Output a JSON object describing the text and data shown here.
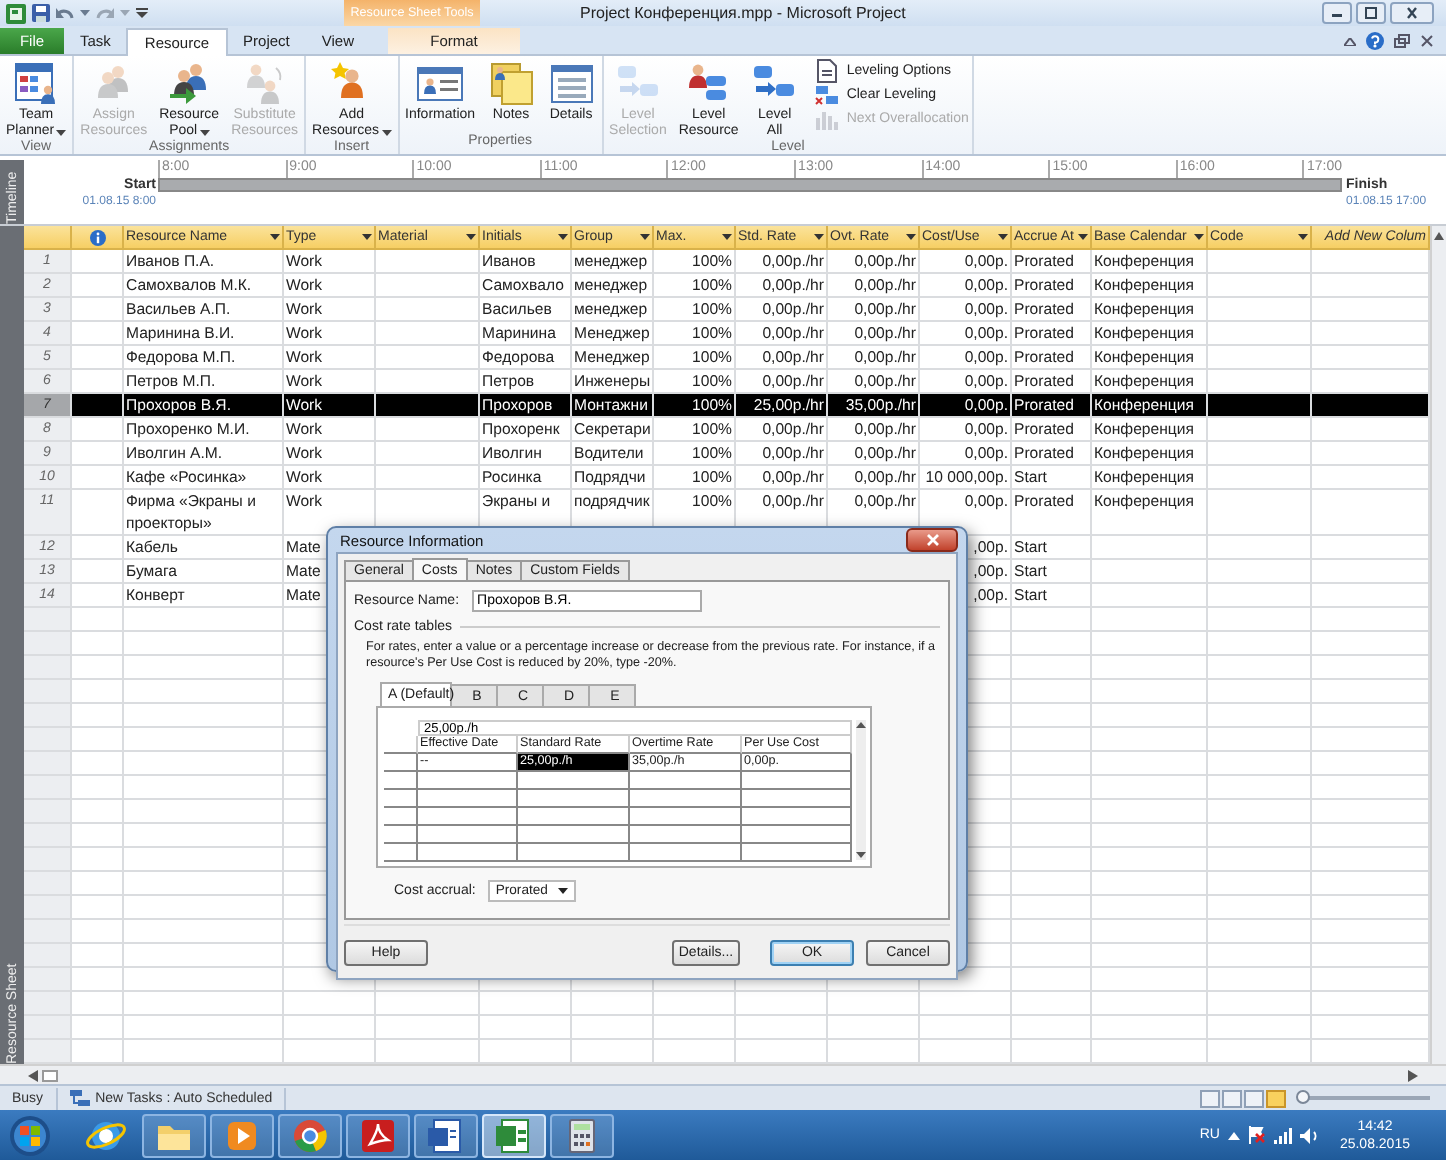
{
  "window": {
    "title": "Project Конференция.mpp - Microsoft Project",
    "contextual_group": "Resource Sheet Tools"
  },
  "tabs": [
    {
      "label": "File",
      "kind": "file",
      "selected": false
    },
    {
      "label": "Task",
      "kind": "normal",
      "selected": false
    },
    {
      "label": "Resource",
      "kind": "normal",
      "selected": true
    },
    {
      "label": "Project",
      "kind": "normal",
      "selected": false
    },
    {
      "label": "View",
      "kind": "normal",
      "selected": false
    },
    {
      "label": "Format",
      "kind": "contextual",
      "selected": false
    }
  ],
  "ribbon": {
    "groups": [
      {
        "label": "View",
        "commands": [
          {
            "lines": [
              "Team",
              "Planner"
            ],
            "dropdown": true,
            "disabled": false,
            "kind": "large"
          }
        ]
      },
      {
        "label": "Assignments",
        "commands": [
          {
            "lines": [
              "Assign",
              "Resources"
            ],
            "dropdown": false,
            "disabled": true,
            "kind": "large"
          },
          {
            "lines": [
              "Resource",
              "Pool"
            ],
            "dropdown": true,
            "disabled": false,
            "kind": "large"
          },
          {
            "lines": [
              "Substitute",
              "Resources"
            ],
            "dropdown": false,
            "disabled": true,
            "kind": "large"
          }
        ]
      },
      {
        "label": "Insert",
        "commands": [
          {
            "lines": [
              "Add",
              "Resources"
            ],
            "dropdown": true,
            "disabled": false,
            "kind": "large"
          }
        ]
      },
      {
        "label": "Properties",
        "commands": [
          {
            "lines": [
              "Information"
            ],
            "dropdown": false,
            "disabled": false,
            "kind": "large"
          },
          {
            "lines": [
              "Notes"
            ],
            "dropdown": false,
            "disabled": false,
            "kind": "large"
          },
          {
            "lines": [
              "Details"
            ],
            "dropdown": false,
            "disabled": false,
            "kind": "large"
          }
        ]
      },
      {
        "label": "Level",
        "commands": [
          {
            "lines": [
              "Level",
              "Selection"
            ],
            "dropdown": false,
            "disabled": true,
            "kind": "large"
          },
          {
            "lines": [
              "Level",
              "Resource"
            ],
            "dropdown": false,
            "disabled": false,
            "kind": "large"
          },
          {
            "lines": [
              "Level",
              "All"
            ],
            "dropdown": false,
            "disabled": false,
            "kind": "large"
          },
          {
            "lines": [
              "Leveling Options"
            ],
            "dropdown": false,
            "disabled": false,
            "kind": "small"
          },
          {
            "lines": [
              "Clear Leveling"
            ],
            "dropdown": false,
            "disabled": false,
            "kind": "small"
          },
          {
            "lines": [
              "Next Overallocation"
            ],
            "dropdown": false,
            "disabled": true,
            "kind": "small"
          }
        ]
      }
    ]
  },
  "timeline": {
    "label": "Timeline",
    "start_label": "Start",
    "start_date": "01.08.15 8:00",
    "finish_label": "Finish",
    "finish_date": "01.08.15 17:00",
    "ticks": [
      "8:00",
      "9:00",
      "10:00",
      "11:00",
      "12:00",
      "13:00",
      "14:00",
      "15:00",
      "16:00",
      "17:00"
    ]
  },
  "sheet": {
    "label": "Resource Sheet",
    "columns": [
      {
        "kind": "indicator"
      },
      {
        "label": "Resource Name",
        "kind": "field"
      },
      {
        "label": "Type",
        "kind": "field"
      },
      {
        "label": "Material",
        "kind": "field"
      },
      {
        "label": "Initials",
        "kind": "field"
      },
      {
        "label": "Group",
        "kind": "field"
      },
      {
        "label": "Max.",
        "kind": "field"
      },
      {
        "label": "Std. Rate",
        "kind": "field"
      },
      {
        "label": "Ovt. Rate",
        "kind": "field"
      },
      {
        "label": "Cost/Use",
        "kind": "field"
      },
      {
        "label": "Accrue At",
        "kind": "field"
      },
      {
        "label": "Base Calendar",
        "kind": "field"
      },
      {
        "label": "Code",
        "kind": "field"
      },
      {
        "label": "Add New Colum",
        "kind": "add"
      }
    ],
    "rows": [
      {
        "number": "1",
        "name": "Иванов П.А.",
        "type": "Work",
        "initials": "Иванов",
        "group": "менеджер",
        "max": "100%",
        "std_rate": "0,00р./hr",
        "ovt_rate": "0,00р./hr",
        "cost_use": "0,00р.",
        "accrue_at": "Prorated",
        "base_calendar": "Конференция",
        "selected": false
      },
      {
        "number": "2",
        "name": "Самохвалов М.К.",
        "type": "Work",
        "initials": "Самохвало",
        "group": "менеджер",
        "max": "100%",
        "std_rate": "0,00р./hr",
        "ovt_rate": "0,00р./hr",
        "cost_use": "0,00р.",
        "accrue_at": "Prorated",
        "base_calendar": "Конференция",
        "selected": false
      },
      {
        "number": "3",
        "name": "Васильев А.П.",
        "type": "Work",
        "initials": "Васильев",
        "group": "менеджер",
        "max": "100%",
        "std_rate": "0,00р./hr",
        "ovt_rate": "0,00р./hr",
        "cost_use": "0,00р.",
        "accrue_at": "Prorated",
        "base_calendar": "Конференция",
        "selected": false
      },
      {
        "number": "4",
        "name": "Маринина В.И.",
        "type": "Work",
        "initials": "Маринина",
        "group": "Менеджер",
        "max": "100%",
        "std_rate": "0,00р./hr",
        "ovt_rate": "0,00р./hr",
        "cost_use": "0,00р.",
        "accrue_at": "Prorated",
        "base_calendar": "Конференция",
        "selected": false
      },
      {
        "number": "5",
        "name": "Федорова М.П.",
        "type": "Work",
        "initials": "Федорова",
        "group": "Менеджер",
        "max": "100%",
        "std_rate": "0,00р./hr",
        "ovt_rate": "0,00р./hr",
        "cost_use": "0,00р.",
        "accrue_at": "Prorated",
        "base_calendar": "Конференция",
        "selected": false
      },
      {
        "number": "6",
        "name": "Петров М.П.",
        "type": "Work",
        "initials": "Петров",
        "group": "Инженеры",
        "max": "100%",
        "std_rate": "0,00р./hr",
        "ovt_rate": "0,00р./hr",
        "cost_use": "0,00р.",
        "accrue_at": "Prorated",
        "base_calendar": "Конференция",
        "selected": false
      },
      {
        "number": "7",
        "name": "Прохоров В.Я.",
        "type": "Work",
        "initials": "Прохоров",
        "group": "Монтажни",
        "max": "100%",
        "std_rate": "25,00р./hr",
        "ovt_rate": "35,00р./hr",
        "cost_use": "0,00р.",
        "accrue_at": "Prorated",
        "base_calendar": "Конференция",
        "selected": true
      },
      {
        "number": "8",
        "name": "Прохоренко М.И.",
        "type": "Work",
        "initials": "Прохоренк",
        "group": "Секретари",
        "max": "100%",
        "std_rate": "0,00р./hr",
        "ovt_rate": "0,00р./hr",
        "cost_use": "0,00р.",
        "accrue_at": "Prorated",
        "base_calendar": "Конференция",
        "selected": false
      },
      {
        "number": "9",
        "name": "Иволгин А.М.",
        "type": "Work",
        "initials": "Иволгин",
        "group": "Водители",
        "max": "100%",
        "std_rate": "0,00р./hr",
        "ovt_rate": "0,00р./hr",
        "cost_use": "0,00р.",
        "accrue_at": "Prorated",
        "base_calendar": "Конференция",
        "selected": false
      },
      {
        "number": "10",
        "name": "Кафе «Росинка»",
        "type": "Work",
        "initials": "Росинка",
        "group": "Подрядчи",
        "max": "100%",
        "std_rate": "0,00р./hr",
        "ovt_rate": "0,00р./hr",
        "cost_use": "10 000,00р.",
        "accrue_at": "Start",
        "base_calendar": "Конференция",
        "selected": false
      },
      {
        "number": "11",
        "name": "Фирма «Экраны и проекторы»",
        "type": "Work",
        "initials": "Экраны и",
        "group": "подрядчик",
        "max": "100%",
        "std_rate": "0,00р./hr",
        "ovt_rate": "0,00р./hr",
        "cost_use": "0,00р.",
        "accrue_at": "Prorated",
        "base_calendar": "Конференция",
        "selected": false
      },
      {
        "number": "12",
        "name": "Кабель",
        "type": "Mate",
        "cost_use": ",00р.",
        "accrue_at": "Start",
        "selected": false
      },
      {
        "number": "13",
        "name": "Бумага",
        "type": "Mate",
        "cost_use": ",00р.",
        "accrue_at": "Start",
        "selected": false
      },
      {
        "number": "14",
        "name": "Конверт",
        "type": "Mate",
        "cost_use": ",00р.",
        "accrue_at": "Start",
        "selected": false
      }
    ]
  },
  "dialog": {
    "title": "Resource Information",
    "tabs": [
      {
        "label": "General",
        "selected": false
      },
      {
        "label": "Costs",
        "selected": true
      },
      {
        "label": "Notes",
        "selected": false
      },
      {
        "label": "Custom Fields",
        "selected": false
      }
    ],
    "name_label": "Resource Name:",
    "name_value": "Прохоров В.Я.",
    "section_label": "Cost rate tables",
    "hint": "For rates, enter a value or a percentage increase or decrease from the previous rate. For instance, if a resource's Per Use Cost is reduced by 20%, type -20%.",
    "rate_tabs": [
      {
        "label": "A (Default)",
        "selected": true
      },
      {
        "label": "B",
        "selected": false
      },
      {
        "label": "C",
        "selected": false
      },
      {
        "label": "D",
        "selected": false
      },
      {
        "label": "E",
        "selected": false
      }
    ],
    "entry_value": "25,00р./h",
    "grid_columns": [
      "Effective Date",
      "Standard Rate",
      "Overtime Rate",
      "Per Use Cost"
    ],
    "grid_rows": [
      {
        "cells": [
          {
            "text": "--",
            "selected": false
          },
          {
            "text": "25,00р./h",
            "selected": true
          },
          {
            "text": "35,00р./h",
            "selected": false
          },
          {
            "text": "0,00р.",
            "selected": false
          }
        ]
      }
    ],
    "accrual_label": "Cost accrual:",
    "accrual_value": "Prorated",
    "buttons": [
      {
        "label": "Help",
        "default": false
      },
      {
        "label": "Details...",
        "default": false
      },
      {
        "label": "OK",
        "default": true
      },
      {
        "label": "Cancel",
        "default": false
      }
    ]
  },
  "status_bar": {
    "mode": "Busy",
    "task_mode": "New Tasks : Auto Scheduled",
    "views": [
      {
        "selected": false
      },
      {
        "selected": false
      },
      {
        "selected": false
      },
      {
        "selected": true
      }
    ],
    "zoom": {
      "level": 0
    }
  },
  "taskbar": {
    "apps": [
      {
        "running": false,
        "selected": false
      },
      {
        "running": true,
        "selected": false
      },
      {
        "running": true,
        "selected": false
      },
      {
        "running": true,
        "selected": false
      },
      {
        "running": true,
        "selected": false
      },
      {
        "running": true,
        "selected": false
      },
      {
        "running": true,
        "selected": true
      },
      {
        "running": true,
        "selected": false
      }
    ],
    "language": "RU",
    "time": "14:42",
    "date": "25.08.2015"
  }
}
